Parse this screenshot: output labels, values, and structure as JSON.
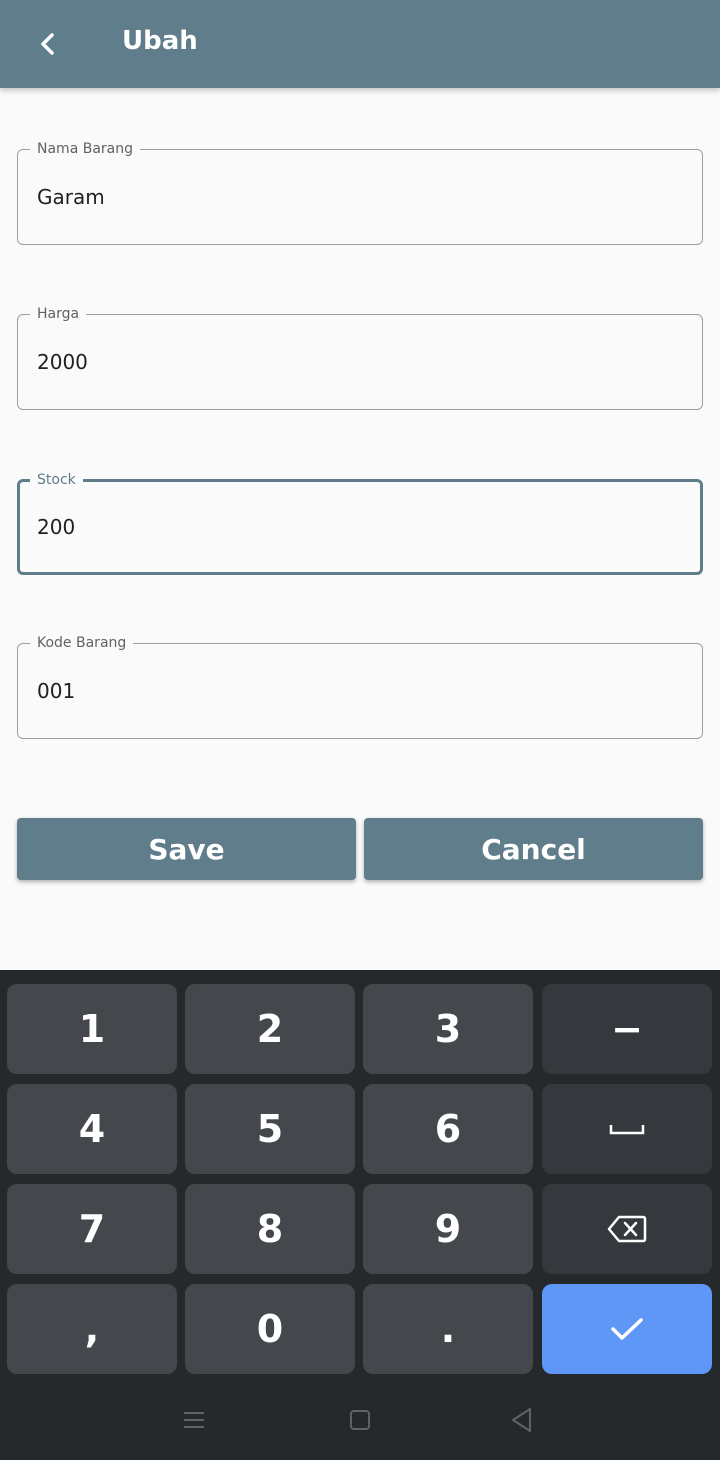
{
  "appbar": {
    "title": "Ubah",
    "back_icon": "arrow-back-icon"
  },
  "form": {
    "nama_barang": {
      "label": "Nama Barang",
      "value": "Garam"
    },
    "harga": {
      "label": "Harga",
      "value": "2000"
    },
    "stock": {
      "label": "Stock",
      "value": "200"
    },
    "kode_barang": {
      "label": "Kode Barang",
      "value": "001"
    }
  },
  "buttons": {
    "save": "Save",
    "cancel": "Cancel"
  },
  "keyboard": {
    "row1": [
      "1",
      "2",
      "3",
      "−"
    ],
    "row2": [
      "4",
      "5",
      "6"
    ],
    "row3": [
      "7",
      "8",
      "9"
    ],
    "row4": [
      ",",
      "0",
      "."
    ],
    "space_icon": "space-bar-icon",
    "backspace_icon": "backspace-icon",
    "enter_icon": "check-icon"
  },
  "navbar": {
    "icons": [
      "menu-icon",
      "home-square-icon",
      "back-triangle-icon"
    ]
  },
  "colors": {
    "primary": "#607d8b",
    "background": "#fafafa",
    "keyboard_bg": "#25292c",
    "key": "#44484c",
    "key_function": "#35393d",
    "enter_key": "#5e97f6"
  }
}
